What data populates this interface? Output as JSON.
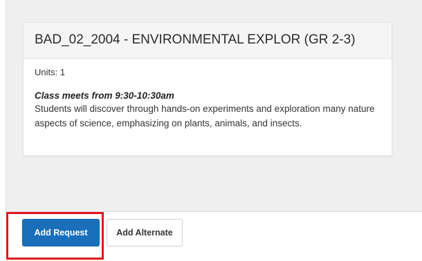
{
  "course": {
    "title": "BAD_02_2004 - ENVIRONMENTAL EXPLOR (GR 2-3)",
    "units": "Units: 1",
    "meeting_time": "Class meets from 9:30-10:30am",
    "description": "Students will discover through hands-on experiments and exploration many nature aspects of science, emphasizing on plants, animals, and insects."
  },
  "footer": {
    "add_request_label": "Add Request",
    "add_alternate_label": "Add Alternate"
  },
  "colors": {
    "primary_button": "#1b6fba",
    "highlight": "#e3161b",
    "background": "#efefef"
  }
}
